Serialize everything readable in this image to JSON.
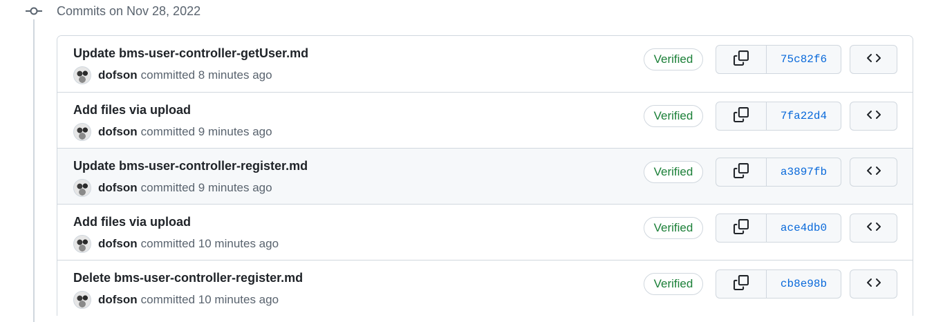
{
  "group": {
    "title": "Commits on Nov 28, 2022",
    "icon": "git-commit-icon"
  },
  "commits": [
    {
      "title": "Update bms-user-controller-getUser.md",
      "author": "dofson",
      "time_text": "committed 8 minutes ago",
      "verified_label": "Verified",
      "sha": "75c82f6"
    },
    {
      "title": "Add files via upload",
      "author": "dofson",
      "time_text": "committed 9 minutes ago",
      "verified_label": "Verified",
      "sha": "7fa22d4"
    },
    {
      "title": "Update bms-user-controller-register.md",
      "author": "dofson",
      "time_text": "committed 9 minutes ago",
      "verified_label": "Verified",
      "sha": "a3897fb"
    },
    {
      "title": "Add files via upload",
      "author": "dofson",
      "time_text": "committed 10 minutes ago",
      "verified_label": "Verified",
      "sha": "ace4db0"
    },
    {
      "title": "Delete bms-user-controller-register.md",
      "author": "dofson",
      "time_text": "committed 10 minutes ago",
      "verified_label": "Verified",
      "sha": "cb8e98b"
    }
  ],
  "icons": {
    "copy": "copy-icon",
    "browse": "code-icon"
  },
  "colors": {
    "verified": "#1a7f37",
    "sha_link": "#0969da",
    "border": "#d0d7de",
    "hover_row": "#f6f8fa"
  }
}
